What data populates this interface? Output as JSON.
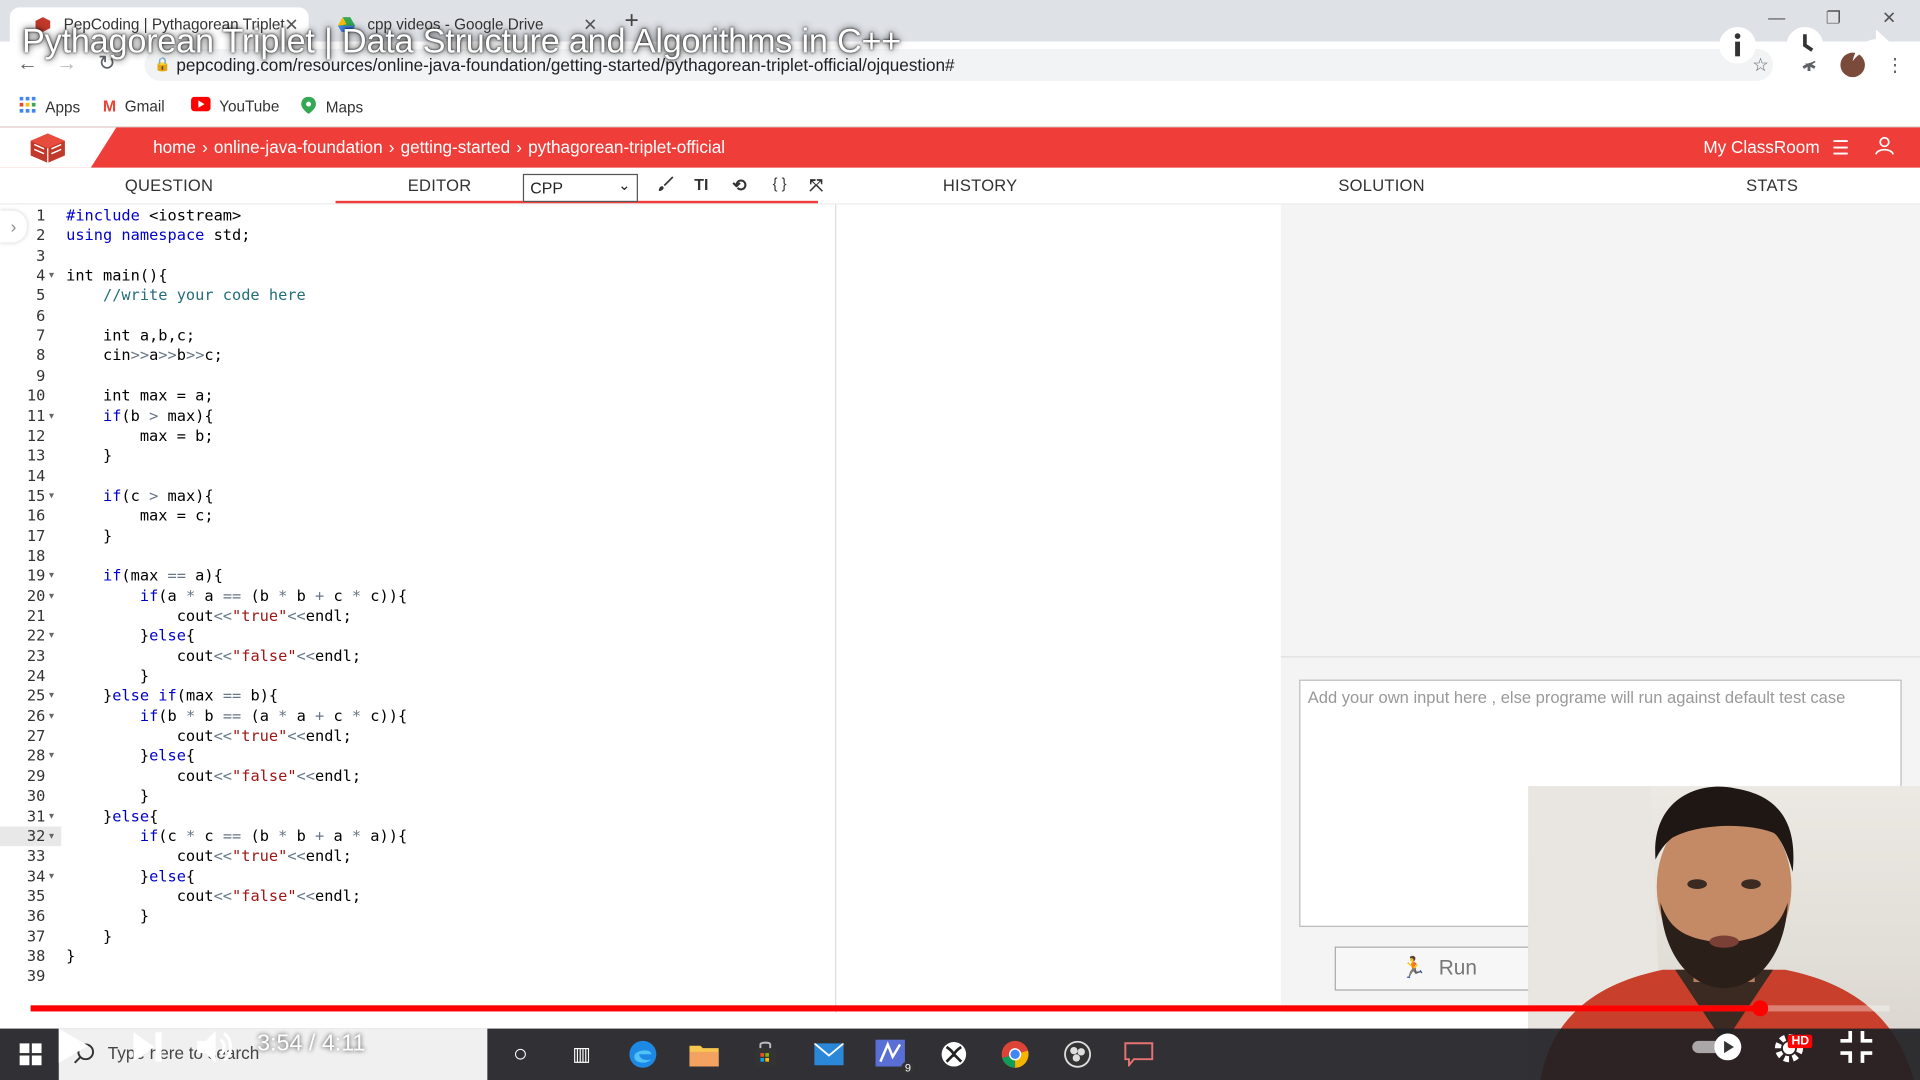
{
  "browser": {
    "tabs": [
      {
        "title": "PepCoding | Pythagorean Triplet",
        "active": true
      },
      {
        "title": "cpp videos - Google Drive",
        "active": false
      }
    ],
    "url": "pepcoding.com/resources/online-java-foundation/getting-started/pythagorean-triplet-official/ojquestion#",
    "bookmarks": [
      "Apps",
      "Gmail",
      "YouTube",
      "Maps"
    ]
  },
  "video": {
    "title": "Pythagorean Triplet | Data Structure and Algorithms in C++",
    "time": "3:54 / 4:11",
    "progress_fraction": 0.93,
    "hd_badge": "HD"
  },
  "site": {
    "breadcrumb": [
      "home",
      "online-java-foundation",
      "getting-started",
      "pythagorean-triplet-official"
    ],
    "classroom": "My ClassRoom"
  },
  "panel_tabs": {
    "question": "QUESTION",
    "editor": "EDITOR",
    "history": "HISTORY",
    "solution": "SOLUTION",
    "stats": "STATS"
  },
  "editor": {
    "language": "CPP",
    "current_line": 32,
    "fold_lines": [
      4,
      11,
      15,
      19,
      20,
      22,
      25,
      26,
      28,
      31,
      32,
      34
    ],
    "code": [
      "#include <iostream>",
      "using namespace std;",
      "",
      "int main(){",
      "    //write your code here",
      "",
      "    int a,b,c;",
      "    cin>>a>>b>>c;",
      "",
      "    int max = a;",
      "    if(b > max){",
      "        max = b;",
      "    }",
      "",
      "    if(c > max){",
      "        max = c;",
      "    }",
      "",
      "    if(max == a){",
      "        if(a * a == (b * b + c * c)){",
      "            cout<<\"true\"<<endl;",
      "        }else{",
      "            cout<<\"false\"<<endl;",
      "        }",
      "    }else if(max == b){",
      "        if(b * b == (a * a + c * c)){",
      "            cout<<\"true\"<<endl;",
      "        }else{",
      "            cout<<\"false\"<<endl;",
      "        }",
      "    }else{",
      "        if(c * c == (b * b + a * a)){",
      "            cout<<\"true\"<<endl;",
      "        }else{",
      "            cout<<\"false\"<<endl;",
      "        }",
      "    }",
      "}",
      ""
    ]
  },
  "input": {
    "placeholder": "Add your own input here , else programe will run against default test case",
    "run_label": "Run"
  },
  "taskbar": {
    "search_placeholder": "Type here to search",
    "mail_badge": "9"
  },
  "colors": {
    "brand_red": "#ef3e3a",
    "progress_red": "#ff0000",
    "keyword_blue": "#0000cc",
    "comment_teal": "#236e7a",
    "string_green": "#1a1aa6"
  }
}
